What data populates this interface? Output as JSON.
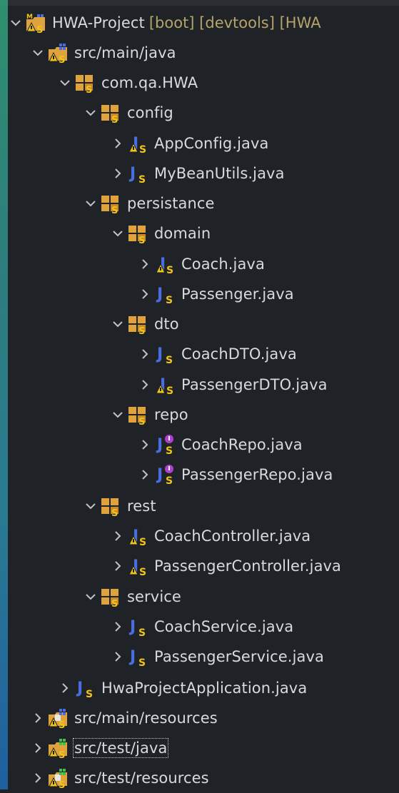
{
  "explorer": {
    "project": {
      "name": "HWA-Project",
      "decoration": "[boot] [devtools] [HWA"
    },
    "items": [
      {
        "label": "src/main/java",
        "icon": "source-folder-icon",
        "expanded": true
      },
      {
        "label": "com.qa.HWA",
        "icon": "package-icon",
        "expanded": true
      },
      {
        "label": "config",
        "icon": "package-icon",
        "expanded": true
      },
      {
        "label": "AppConfig.java",
        "icon": "java-class-warning-icon",
        "expanded": false
      },
      {
        "label": "MyBeanUtils.java",
        "icon": "java-class-icon",
        "expanded": false
      },
      {
        "label": "persistance",
        "icon": "package-icon",
        "expanded": true
      },
      {
        "label": "domain",
        "icon": "package-icon",
        "expanded": true
      },
      {
        "label": "Coach.java",
        "icon": "java-class-warning-icon",
        "expanded": false
      },
      {
        "label": "Passenger.java",
        "icon": "java-class-icon",
        "expanded": false
      },
      {
        "label": "dto",
        "icon": "package-icon",
        "expanded": true
      },
      {
        "label": "CoachDTO.java",
        "icon": "java-class-icon",
        "expanded": false
      },
      {
        "label": "PassengerDTO.java",
        "icon": "java-class-warning-icon",
        "expanded": false
      },
      {
        "label": "repo",
        "icon": "package-icon",
        "expanded": true
      },
      {
        "label": "CoachRepo.java",
        "icon": "java-interface-icon",
        "expanded": false
      },
      {
        "label": "PassengerRepo.java",
        "icon": "java-interface-icon",
        "expanded": false
      },
      {
        "label": "rest",
        "icon": "package-icon",
        "expanded": true
      },
      {
        "label": "CoachController.java",
        "icon": "java-class-warning-icon",
        "expanded": false
      },
      {
        "label": "PassengerController.java",
        "icon": "java-class-warning-icon",
        "expanded": false
      },
      {
        "label": "service",
        "icon": "package-icon",
        "expanded": true
      },
      {
        "label": "CoachService.java",
        "icon": "java-class-icon",
        "expanded": false
      },
      {
        "label": "PassengerService.java",
        "icon": "java-class-icon",
        "expanded": false
      },
      {
        "label": "HwaProjectApplication.java",
        "icon": "java-class-icon",
        "expanded": false
      },
      {
        "label": "src/main/resources",
        "icon": "resource-folder-icon",
        "expanded": false
      },
      {
        "label": "src/test/java",
        "icon": "test-source-folder-icon",
        "expanded": false,
        "selected": true
      },
      {
        "label": "src/test/resources",
        "icon": "test-resource-folder-icon",
        "expanded": false
      }
    ]
  },
  "colors": {
    "background": "#1f2226",
    "text": "#d8dadd",
    "decoration": "#b5a46a",
    "java_blue": "#4a6ee0",
    "package_orange": "#e0a23c",
    "warning_yellow": "#f0c419",
    "interface_purple": "#b040d0"
  }
}
